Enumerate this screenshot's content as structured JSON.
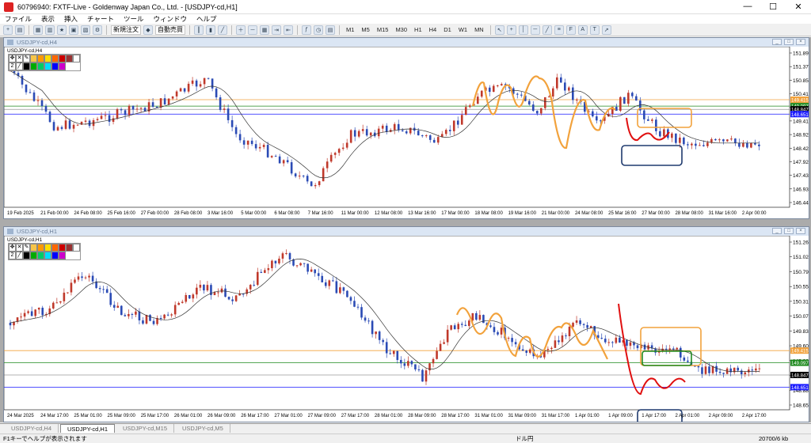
{
  "window": {
    "title": "60796940: FXTF-Live - Goldenway Japan Co., Ltd. - [USDJPY-cd,H1]",
    "min": "—",
    "max": "☐",
    "close": "✕"
  },
  "menu": [
    "ファイル",
    "表示",
    "挿入",
    "チャート",
    "ツール",
    "ウィンドウ",
    "ヘルプ"
  ],
  "toolbar": {
    "new_order": "新規注文",
    "auto_trade": "自動売買",
    "timeframes": [
      "M1",
      "M5",
      "M15",
      "M30",
      "H1",
      "H4",
      "D1",
      "W1",
      "MN"
    ]
  },
  "chart_windows": [
    {
      "window_title": "USDJPY-cd,H4",
      "symbol_label": "USDJPY-cd,H4",
      "y_ticks": [
        "151.890",
        "151.370",
        "150.850",
        "150.410",
        "149.930",
        "149.415",
        "148.920",
        "148.420",
        "147.920",
        "147.430",
        "146.930",
        "146.440"
      ],
      "price_labels": [
        {
          "text": "149.415",
          "color": "#f2a23c"
        },
        {
          "text": "149.097",
          "color": "#1f8a1f"
        },
        {
          "text": "148.847",
          "color": "#000000"
        },
        {
          "text": "148.651",
          "color": "#1a1aff"
        }
      ],
      "x_ticks": [
        "19 Feb 2025",
        "21 Feb 00:00",
        "24 Feb 08:00",
        "25 Feb 16:00",
        "27 Feb 00:00",
        "28 Feb 08:00",
        "3 Mar 16:00",
        "5 Mar 00:00",
        "6 Mar 08:00",
        "7 Mar 16:00",
        "11 Mar 00:00",
        "12 Mar 08:00",
        "13 Mar 16:00",
        "17 Mar 00:00",
        "18 Mar 08:00",
        "19 Mar 16:00",
        "21 Mar 00:00",
        "24 Mar 08:00",
        "25 Mar 16:00",
        "27 Mar 00:00",
        "28 Mar 08:00",
        "31 Mar 16:00",
        "2 Apr 00:00"
      ]
    },
    {
      "window_title": "USDJPY-cd,H1",
      "symbol_label": "USDJPY-cd,H1",
      "y_ticks": [
        "151.265",
        "151.025",
        "150.790",
        "150.550",
        "150.310",
        "150.075",
        "149.835",
        "149.600",
        "149.360",
        "149.097",
        "148.885",
        "148.651"
      ],
      "price_labels": [
        {
          "text": "149.415",
          "color": "#f2a23c"
        },
        {
          "text": "149.097",
          "color": "#1f8a1f"
        },
        {
          "text": "148.847",
          "color": "#000000"
        },
        {
          "text": "148.651",
          "color": "#1a1aff"
        }
      ],
      "x_ticks": [
        "24 Mar 2025",
        "24 Mar 17:00",
        "25 Mar 01:00",
        "25 Mar 09:00",
        "25 Mar 17:00",
        "26 Mar 01:00",
        "26 Mar 09:00",
        "26 Mar 17:00",
        "27 Mar 01:00",
        "27 Mar 09:00",
        "27 Mar 17:00",
        "28 Mar 01:00",
        "28 Mar 09:00",
        "28 Mar 17:00",
        "31 Mar 01:00",
        "31 Mar 09:00",
        "31 Mar 17:00",
        "1 Apr 01:00",
        "1 Apr 09:00",
        "1 Apr 17:00",
        "2 Apr 01:00",
        "2 Apr 09:00",
        "2 Apr 17:00"
      ]
    }
  ],
  "tabs": [
    "USDJPY-cd,H4",
    "USDJPY-cd,H1",
    "USDJPY-cd,M15",
    "USDJPY-cd,M5"
  ],
  "active_tab": 1,
  "status": {
    "help": "F1キーでヘルプが表示されます",
    "profile": "ドル円",
    "traffic": "20700/6 kb"
  },
  "colors": {
    "bull": "#c0392b",
    "bear": "#2b4bb5",
    "orange": "#f2a23c",
    "green": "#1f8a1f",
    "blue_line": "#1a1aff",
    "navy_box": "#1f3a6e",
    "red_draw": "#e01010"
  }
}
